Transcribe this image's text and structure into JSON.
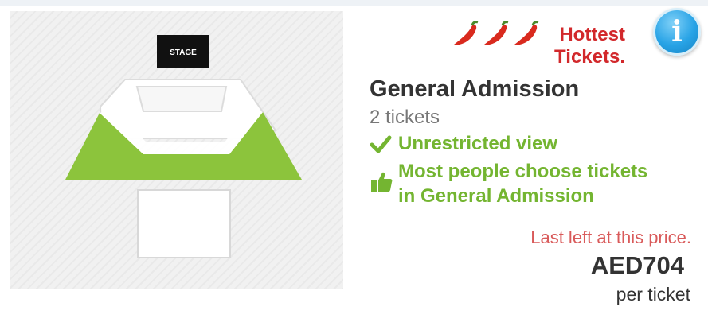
{
  "listing": {
    "badge_line1": "Hottest",
    "badge_line2": "Tickets.",
    "title": "General Admission",
    "tickets": "2 tickets",
    "feature_1": "Unrestricted view",
    "feature_2_line1": "Most people choose tickets",
    "feature_2_line2": "in General Admission",
    "last_left": "Last left at this price.",
    "price": "AED704",
    "price_unit": "per ticket"
  },
  "map": {
    "stage_label": "STAGE",
    "highlight_color": "#8cc43c"
  },
  "icons": {
    "info": "i",
    "chili": "chili-pepper-icon",
    "check": "checkmark-icon",
    "thumb": "thumbs-up-icon"
  },
  "colors": {
    "hot": "#d2282b",
    "feature": "#74b531",
    "last_left": "#d95a5a"
  }
}
